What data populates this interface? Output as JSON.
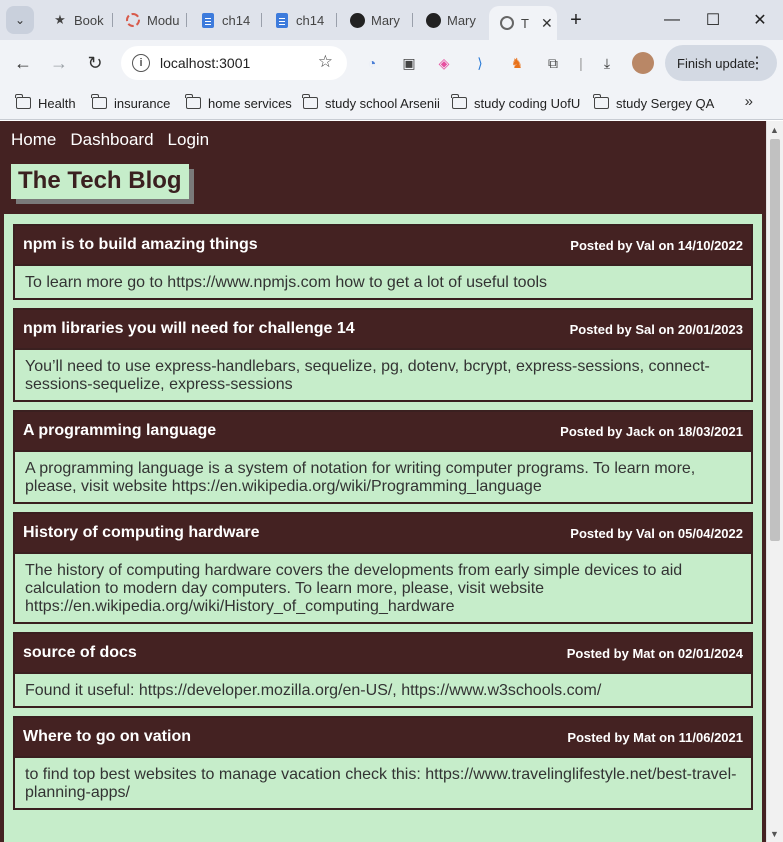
{
  "browser": {
    "tabs": [
      {
        "title": "Book",
        "icon": "star-icon"
      },
      {
        "title": "Modu",
        "icon": "ring-icon"
      },
      {
        "title": "ch14",
        "icon": "doc-icon"
      },
      {
        "title": "ch14",
        "icon": "doc-icon"
      },
      {
        "title": "Mary",
        "icon": "github-icon"
      },
      {
        "title": "Mary",
        "icon": "github-icon"
      },
      {
        "title": "T",
        "icon": "globe-icon"
      }
    ],
    "url": "localhost:3001",
    "finish_update": "Finish update",
    "bookmarks": [
      "Health",
      "insurance",
      "home services",
      "study school Arsenii",
      "study coding UofU",
      "study Sergey QA"
    ]
  },
  "site": {
    "nav": [
      "Home",
      "Dashboard",
      "Login"
    ],
    "brand": "The Tech Blog"
  },
  "posts": [
    {
      "title": "npm is to build amazing things",
      "meta": "Posted by Val on 14/10/2022",
      "body": "To learn more go to https://www.npmjs.com how to get a lot of useful tools"
    },
    {
      "title": "npm libraries you will need for challenge 14",
      "meta": "Posted by Sal on 20/01/2023",
      "body": "You’ll need to use express-handlebars, sequelize, pg, dotenv, bcrypt, express-sessions, connect-sessions-sequelize, express-sessions"
    },
    {
      "title": "A programming language",
      "meta": "Posted by Jack on 18/03/2021",
      "body": "A programming language is a system of notation for writing computer programs. To learn more, please, visit website https://en.wikipedia.org/wiki/Programming_language"
    },
    {
      "title": "History of computing hardware",
      "meta": "Posted by Val on 05/04/2022",
      "body": "The history of computing hardware covers the developments from early simple devices to aid calculation to modern day computers. To learn more, please, visit website https://en.wikipedia.org/wiki/History_of_computing_hardware"
    },
    {
      "title": "source of docs",
      "meta": "Posted by Mat on 02/01/2024",
      "body": "Found it useful: https://developer.mozilla.org/en-US/, https://www.w3schools.com/"
    },
    {
      "title": "Where to go on vation",
      "meta": "Posted by Mat on 11/06/2021",
      "body": "to find top best websites to manage vacation check this: https://www.travelinglifestyle.net/best-travel-planning-apps/"
    }
  ]
}
